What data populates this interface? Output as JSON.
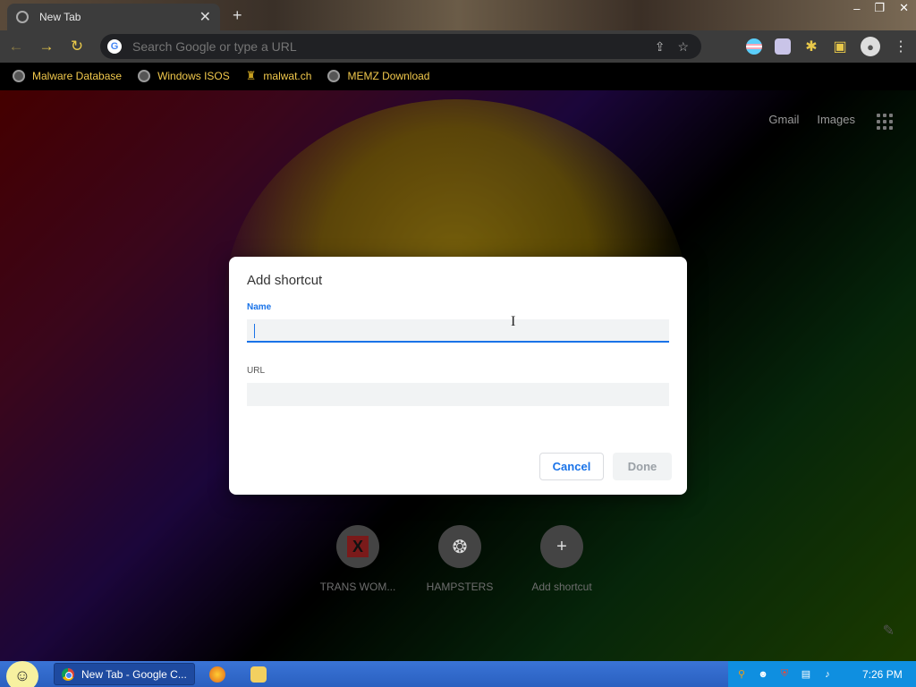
{
  "browser": {
    "tab": {
      "title": "New Tab",
      "close": "✕"
    },
    "new_tab": "+",
    "window_controls": [
      "–",
      "❐",
      "✕"
    ],
    "omnibox": {
      "placeholder": "Search Google or type a URL",
      "value": ""
    }
  },
  "bookmarks": [
    {
      "label": "Malware Database",
      "icon": "globe-icon"
    },
    {
      "label": "Windows ISOS",
      "icon": "globe-icon"
    },
    {
      "label": "malwat.ch",
      "icon": "trophy-icon"
    },
    {
      "label": "MEMZ Download",
      "icon": "globe-icon"
    }
  ],
  "ntp": {
    "links": {
      "gmail": "Gmail",
      "images": "Images"
    },
    "shortcuts": [
      {
        "label": "TRANS WOM...",
        "icon": "x-icon"
      },
      {
        "label": "HAMPSTERS",
        "icon": "raccoon-icon"
      },
      {
        "label": "Add shortcut",
        "icon": "plus-icon"
      }
    ]
  },
  "dialog": {
    "title": "Add shortcut",
    "name_label": "Name",
    "name_value": "",
    "url_label": "URL",
    "url_value": "",
    "cancel": "Cancel",
    "done": "Done"
  },
  "taskbar": {
    "task_label": "New Tab - Google C...",
    "clock": "7:26 PM"
  },
  "colors": {
    "accent": "#1a73e8",
    "bookmark_text": "#f2c94c",
    "toolbar_icon": "#e8c84a",
    "taskbar": "#2a60c0"
  }
}
